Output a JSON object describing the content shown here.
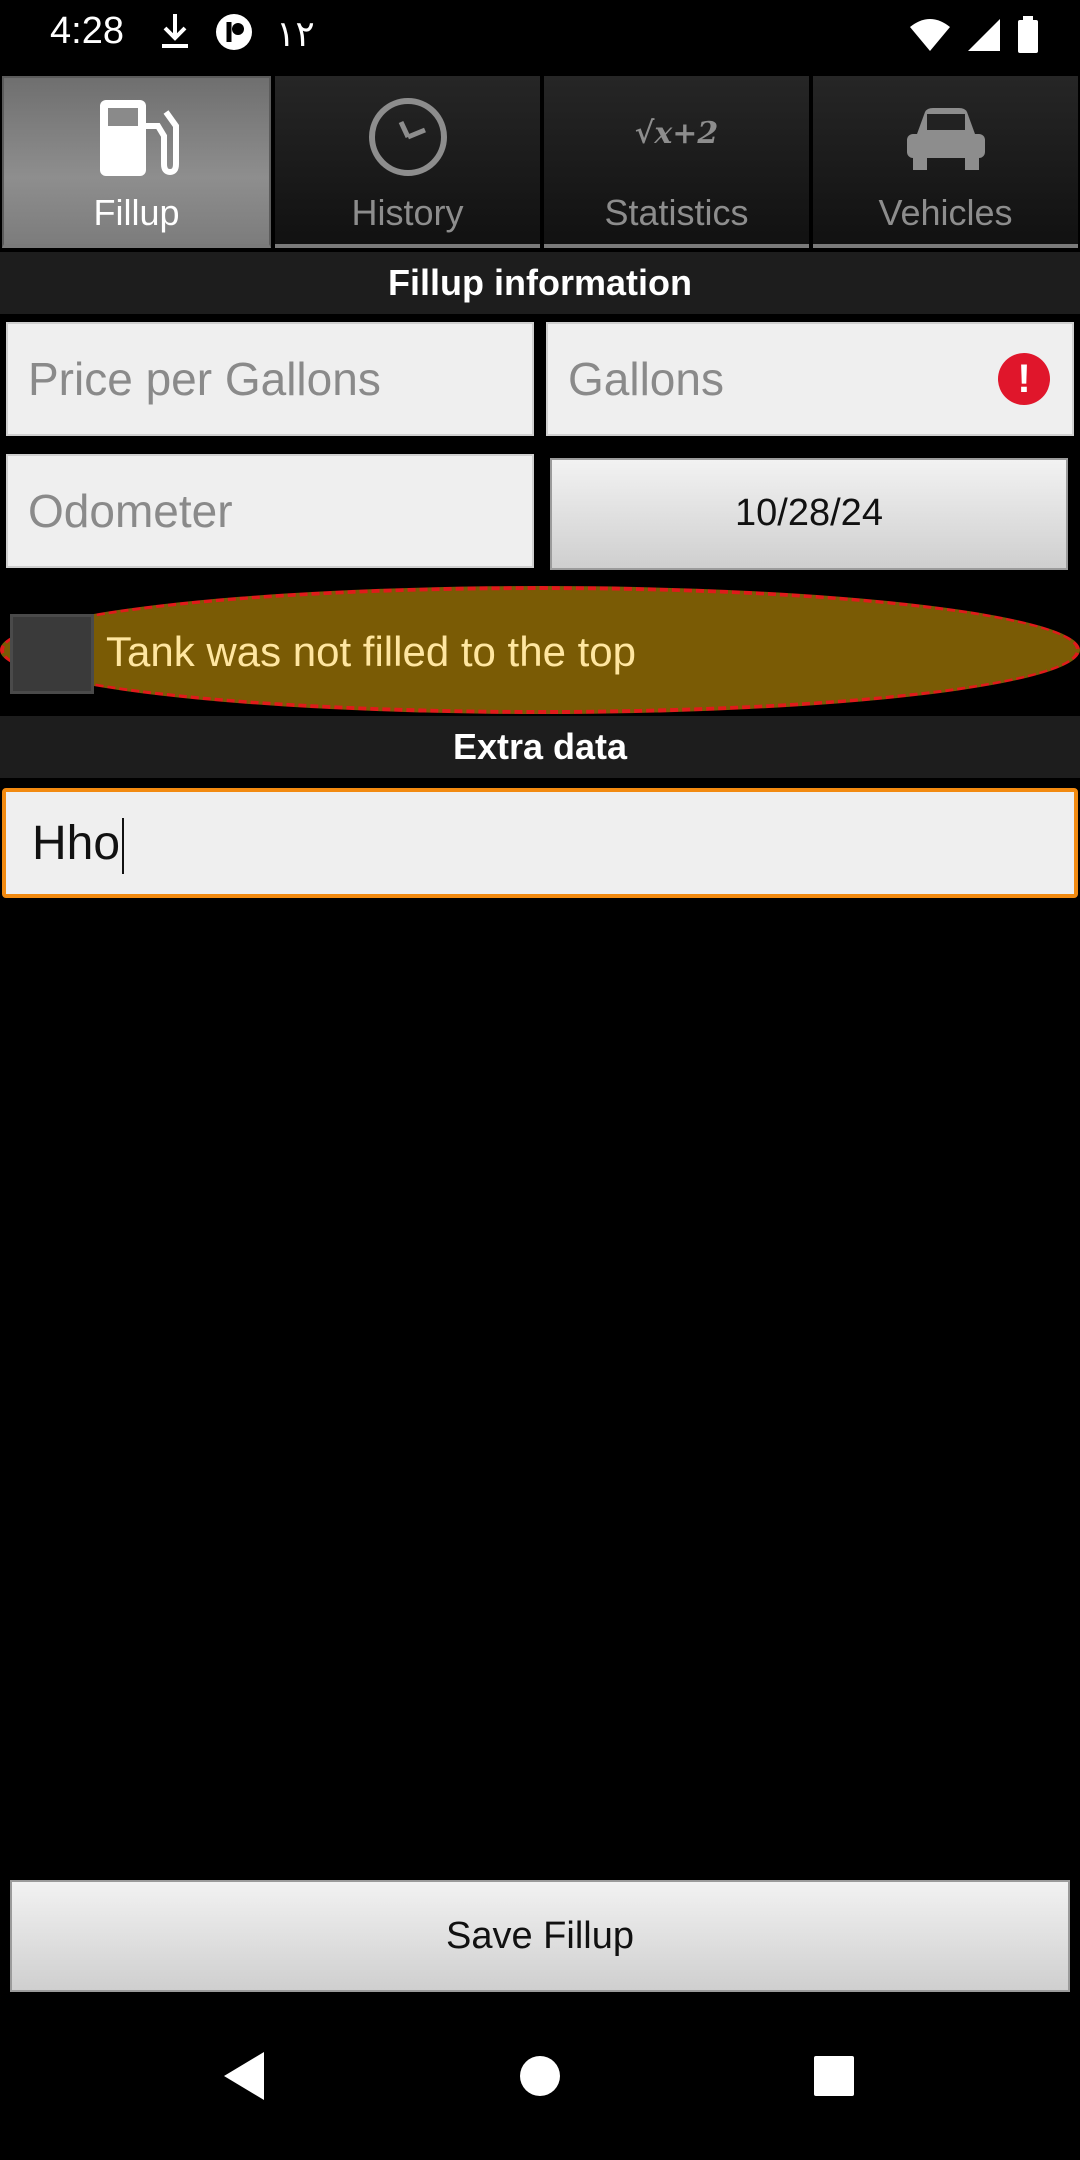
{
  "status_bar": {
    "time": "4:28",
    "extra_indicator": "١٢",
    "icons": [
      "download-icon",
      "app-indicator-icon",
      "wifi-icon",
      "signal-icon",
      "battery-icon"
    ]
  },
  "tabs": [
    {
      "label": "Fillup",
      "icon": "fuel-pump-icon",
      "active": true
    },
    {
      "label": "History",
      "icon": "clock-icon",
      "active": false
    },
    {
      "label": "Statistics",
      "icon": "formula-icon",
      "icon_text": "√x+2",
      "active": false
    },
    {
      "label": "Vehicles",
      "icon": "car-icon",
      "active": false
    }
  ],
  "fillup_section": {
    "header": "Fillup information",
    "price_placeholder": "Price per Gallons",
    "gallons_placeholder": "Gallons",
    "gallons_error_icon": "!",
    "odometer_placeholder": "Odometer",
    "date": "10/28/24",
    "tank_checkbox_label": "Tank was not filled to the top",
    "tank_checkbox_checked": false
  },
  "extra_section": {
    "header": "Extra data",
    "value": "Hho"
  },
  "save_button": "Save Fillup",
  "colors": {
    "accent_focus": "#f28a10",
    "error": "#e0162b",
    "highlight_fill": "#7a5b05",
    "highlight_border": "#e01b1b"
  }
}
